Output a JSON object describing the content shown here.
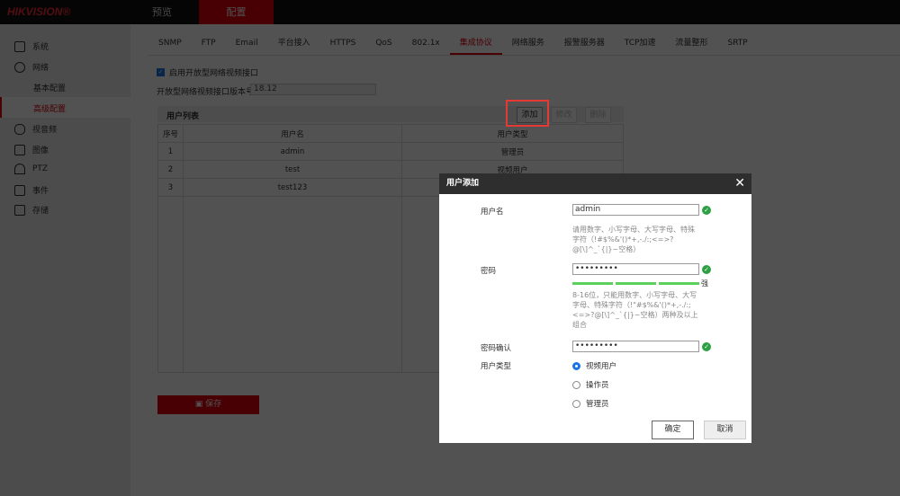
{
  "header": {
    "logo": "HIKVISION®",
    "tabs": [
      {
        "label": "预览"
      },
      {
        "label": "配置",
        "active": true
      }
    ]
  },
  "sidebar": {
    "items": [
      {
        "label": "系统"
      },
      {
        "label": "网络"
      },
      {
        "label": "基本配置"
      },
      {
        "label": "高级配置",
        "active": true
      },
      {
        "label": "视音频"
      },
      {
        "label": "图像"
      },
      {
        "label": "PTZ"
      },
      {
        "label": "事件"
      },
      {
        "label": "存储"
      }
    ]
  },
  "tabs": [
    "SNMP",
    "FTP",
    "Email",
    "平台接入",
    "HTTPS",
    "QoS",
    "802.1x",
    "集成协议",
    "网络服务",
    "报警服务器",
    "TCP加速",
    "流量整形",
    "SRTP"
  ],
  "active_tab": "集成协议",
  "content": {
    "enable_label": "启用开放型网络视频接口",
    "enable_checked": true,
    "version_label": "开放型网络视频接口版本号",
    "version_value": "18.12",
    "user_list_title": "用户列表",
    "add": "添加",
    "modify": "修改",
    "delete": "删除",
    "columns": [
      "序号",
      "用户名",
      "用户类型"
    ],
    "rows": [
      [
        "1",
        "admin",
        "管理员"
      ],
      [
        "2",
        "test",
        "视频用户"
      ],
      [
        "3",
        "test123",
        ""
      ]
    ],
    "save": "保存"
  },
  "dialog": {
    "title": "用户添加",
    "username_label": "用户名",
    "username": "admin",
    "username_hint": "请用数字、小写字母、大写字母、特殊字符（!#$%&'()*+,-./:;<=>?@[\\]^_`{|}~空格）",
    "password_label": "密码",
    "password": "•••••••••",
    "strength": "强",
    "password_hint": "8-16位，只能用数字、小写字母、大写字母、特殊字符（!\"#$%&'()*+,-./:;<=>?@[\\]^_`{|}~空格）两种及以上组合",
    "confirm_label": "密码确认",
    "confirm": "•••••••••",
    "type_label": "用户类型",
    "types": [
      {
        "label": "视频用户",
        "selected": true
      },
      {
        "label": "操作员"
      },
      {
        "label": "管理员"
      }
    ],
    "ok": "确定",
    "cancel": "取消"
  },
  "colors": {
    "accent": "#c7000b",
    "valid": "#2ea043",
    "highlight": "#e53935"
  }
}
